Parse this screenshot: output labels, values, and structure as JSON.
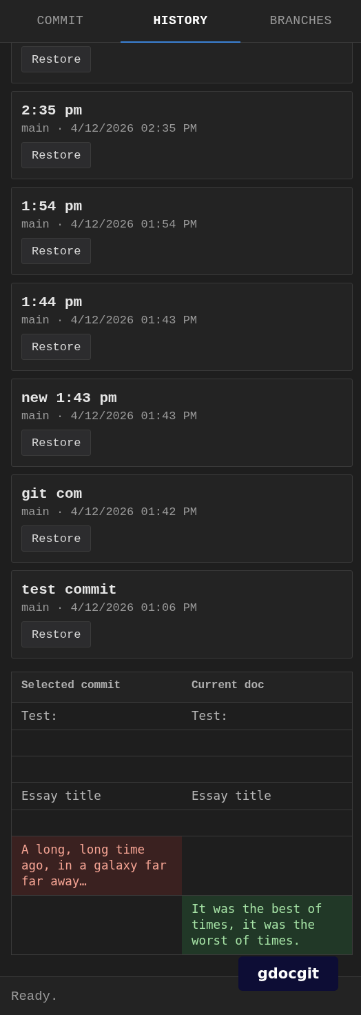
{
  "tabs": [
    {
      "label": "COMMIT",
      "selected": false
    },
    {
      "label": "HISTORY",
      "selected": true
    },
    {
      "label": "BRANCHES",
      "selected": false
    }
  ],
  "commits": [
    {
      "restore": "Restore"
    },
    {
      "title": "2:35 pm",
      "meta": "main · 4/12/2026 02:35 PM",
      "restore": "Restore"
    },
    {
      "title": "1:54 pm",
      "meta": "main · 4/12/2026 01:54 PM",
      "restore": "Restore"
    },
    {
      "title": "1:44 pm",
      "meta": "main · 4/12/2026 01:43 PM",
      "restore": "Restore"
    },
    {
      "title": "new 1:43 pm",
      "meta": "main · 4/12/2026 01:43 PM",
      "restore": "Restore"
    },
    {
      "title": "git com",
      "meta": "main · 4/12/2026 01:42 PM",
      "restore": "Restore"
    },
    {
      "title": "test commit",
      "meta": "main · 4/12/2026 01:06 PM",
      "restore": "Restore"
    }
  ],
  "diff": {
    "columns": [
      "Selected commit",
      "Current doc"
    ],
    "rows": [
      {
        "kind": "same",
        "left": "Test:",
        "right": "Test:"
      },
      {
        "kind": "same"
      },
      {
        "kind": "same"
      },
      {
        "kind": "same",
        "left": "Essay title",
        "right": "Essay title"
      },
      {
        "kind": "same"
      },
      {
        "kind": "removed",
        "left": "A long, long time ago, in a galaxy far far away…"
      },
      {
        "kind": "added",
        "right": "It was the best of times, it was the worst of times."
      }
    ]
  },
  "badge": "gdocgit",
  "status_bar": "Ready."
}
